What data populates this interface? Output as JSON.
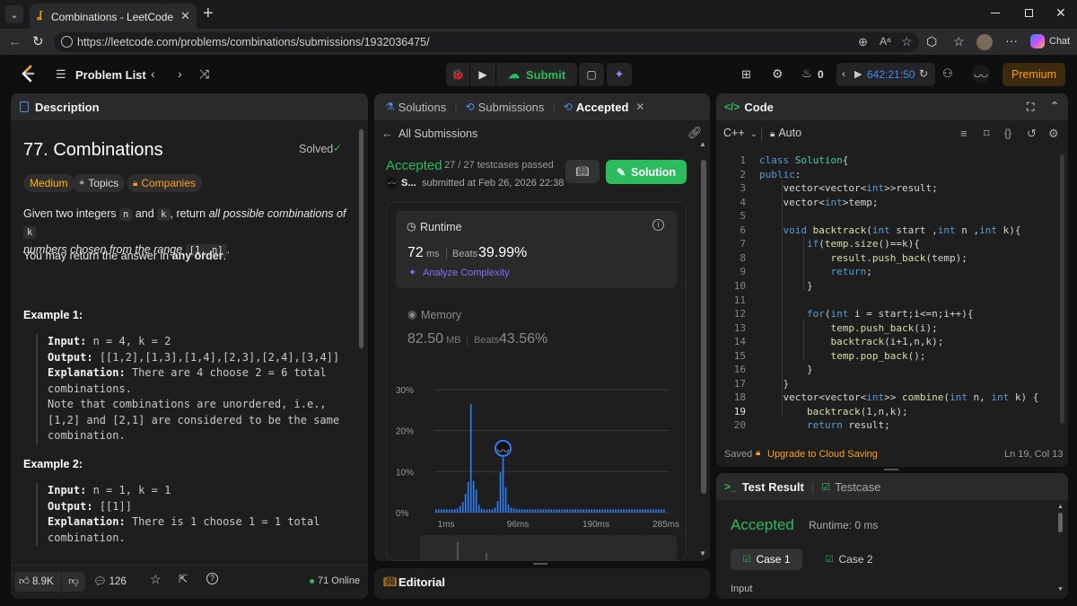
{
  "browser": {
    "tab_title": "Combinations - LeetCode",
    "url": "https://leetcode.com/problems/combinations/submissions/1932036475/",
    "chat_label": "Chat"
  },
  "nav": {
    "problem_list": "Problem List",
    "submit": "Submit",
    "streak": "0",
    "timer": "642:21:50",
    "premium": "Premium"
  },
  "description": {
    "tab": "Description",
    "title": "77. Combinations",
    "solved": "Solved",
    "difficulty": "Medium",
    "topics": "Topics",
    "companies": "Companies",
    "p1_a": "Given two integers",
    "p1_n": "n",
    "p1_and": "and",
    "p1_k": "k",
    "p1_return": ", return",
    "p1_em1": "all possible combinations of",
    "p1_k2": "k",
    "p1_em2": "numbers chosen from the range",
    "p1_range": "[1, n]",
    "p1_dot": ".",
    "p2_a": "You may return the answer in",
    "p2_b": "any order",
    "p2_c": ".",
    "ex1_title": "Example 1:",
    "ex1_input_label": "Input:",
    "ex1_input": "n = 4, k = 2",
    "ex1_output_label": "Output:",
    "ex1_output": "[[1,2],[1,3],[1,4],[2,3],[2,4],[3,4]]",
    "ex1_expl_label": "Explanation:",
    "ex1_expl_1": "There are 4 choose 2 = 6 total",
    "ex1_expl_2": "combinations.",
    "ex1_expl_3": "Note that combinations are unordered, i.e.,",
    "ex1_expl_4": "[1,2] and [2,1] are considered to be the same",
    "ex1_expl_5": "combination.",
    "ex2_title": "Example 2:",
    "ex2_input_label": "Input:",
    "ex2_input": "n = 1, k = 1",
    "ex2_output_label": "Output:",
    "ex2_output": "[[1]]",
    "ex2_expl_label": "Explanation:",
    "ex2_expl_1": "There is 1 choose 1 = 1 total",
    "ex2_expl_2": "combination.",
    "likes": "8.9K",
    "comments": "126",
    "online": "71 Online"
  },
  "submission": {
    "tabs": [
      "Solutions",
      "Submissions",
      "Accepted"
    ],
    "all_submissions": "All Submissions",
    "status": "Accepted",
    "testcases": "27 / 27 testcases passed",
    "user": "S...",
    "submitted": "submitted at Feb 26, 2026 22:38",
    "solution_btn": "Solution",
    "runtime_label": "Runtime",
    "runtime_value": "72",
    "runtime_unit": "ms",
    "beats_label": "Beats",
    "runtime_beats": "39.99%",
    "analyze": "Analyze Complexity",
    "memory_label": "Memory",
    "memory_value": "82.50",
    "memory_unit": "MB",
    "memory_beats": "43.56%",
    "editorial": "Editorial"
  },
  "chart_data": {
    "type": "bar",
    "title": "",
    "xlabel": "",
    "ylabel": "",
    "ylim": [
      0,
      30
    ],
    "yticks": [
      "30%",
      "20%",
      "10%",
      "0%"
    ],
    "xticks": [
      "1ms",
      "96ms",
      "190ms",
      "285ms"
    ],
    "series": [
      {
        "values": [
          0.8,
          0.8,
          0.8,
          0.8,
          0.8,
          0.8,
          0.8,
          0.8,
          1,
          1.6,
          2.6,
          4.6,
          7.5,
          26.5,
          7.7,
          5.6,
          1.9,
          1,
          0.8,
          0.8,
          0.8,
          0.8,
          1.2,
          2.8,
          9.8,
          13.5,
          6.2,
          2,
          1.2,
          1,
          0.9,
          0.8,
          0.8,
          0.8,
          0.8,
          0.8,
          0.8,
          0.8,
          0.8,
          0.8,
          0.8,
          0.8,
          0.8,
          0.8,
          0.8,
          0.8,
          0.8,
          0.8,
          0.8,
          0.8,
          0.8,
          0.8,
          0.8,
          0.8,
          0.8,
          0.8,
          0.8,
          0.8,
          0.8,
          0.8,
          0.8,
          0.8,
          0.8,
          0.8,
          0.8,
          0.8,
          0.8,
          0.8,
          0.8,
          0.8,
          0.8,
          0.8,
          0.8,
          0.8,
          0.8,
          0.8,
          0.8,
          0.8,
          0.8,
          0.8,
          0.8,
          0.8,
          0.8,
          0.8,
          0.8,
          0.8
        ]
      }
    ],
    "highlight_index": 25,
    "grid": true,
    "bar_color": "#2d7ff9"
  },
  "code": {
    "tab": "Code",
    "language": "C++",
    "auto": "Auto",
    "lines": [
      [
        [
          "kw",
          "class "
        ],
        [
          "ty",
          "Solution"
        ],
        [
          "",
          "{"
        ]
      ],
      [
        [
          "kw",
          "public"
        ],
        [
          "",
          ":"
        ]
      ],
      [
        [
          "",
          "    vector<vector<"
        ],
        [
          "kw",
          "int"
        ],
        [
          "",
          ">>result;"
        ]
      ],
      [
        [
          "",
          "    vector<"
        ],
        [
          "kw",
          "int"
        ],
        [
          "",
          ">temp;"
        ]
      ],
      [
        [
          "",
          ""
        ]
      ],
      [
        [
          "",
          "    "
        ],
        [
          "kw",
          "void "
        ],
        [
          "fn",
          "backtrack"
        ],
        [
          "",
          "("
        ],
        [
          "kw",
          "int "
        ],
        [
          "",
          "start ,"
        ],
        [
          "kw",
          "int "
        ],
        [
          "",
          "n ,"
        ],
        [
          "kw",
          "int "
        ],
        [
          "",
          "k){"
        ]
      ],
      [
        [
          "",
          "        "
        ],
        [
          "kw",
          "if"
        ],
        [
          "",
          "("
        ],
        [
          "fn",
          "temp.size"
        ],
        [
          "",
          "()==k){"
        ]
      ],
      [
        [
          "",
          "            "
        ],
        [
          "fn",
          "result.push_back"
        ],
        [
          "",
          "(temp);"
        ]
      ],
      [
        [
          "",
          "            "
        ],
        [
          "kw",
          "return"
        ],
        [
          "",
          ";"
        ]
      ],
      [
        [
          "",
          "        }"
        ]
      ],
      [
        [
          "",
          ""
        ]
      ],
      [
        [
          "",
          "        "
        ],
        [
          "kw",
          "for"
        ],
        [
          "",
          "("
        ],
        [
          "kw",
          "int "
        ],
        [
          "",
          "i = start;i<=n;i++){"
        ]
      ],
      [
        [
          "",
          "            "
        ],
        [
          "fn",
          "temp.push_back"
        ],
        [
          "",
          "(i);"
        ]
      ],
      [
        [
          "",
          "            "
        ],
        [
          "fn",
          "backtrack"
        ],
        [
          "",
          "(i+1,n,k);"
        ]
      ],
      [
        [
          "",
          "            "
        ],
        [
          "fn",
          "temp.pop_back"
        ],
        [
          "",
          "();"
        ]
      ],
      [
        [
          "",
          "        }"
        ]
      ],
      [
        [
          "",
          "    }"
        ]
      ],
      [
        [
          "",
          "    vector<vector<"
        ],
        [
          "kw",
          "int"
        ],
        [
          "",
          ">> "
        ],
        [
          "fn",
          "combine"
        ],
        [
          "",
          "("
        ],
        [
          "kw",
          "int "
        ],
        [
          "",
          "n, "
        ],
        [
          "kw",
          "int "
        ],
        [
          "",
          "k) {"
        ]
      ],
      [
        [
          "",
          "        "
        ],
        [
          "fn",
          "backtrack"
        ],
        [
          "",
          "(1,n,k);"
        ]
      ],
      [
        [
          "",
          "        "
        ],
        [
          "kw",
          "return "
        ],
        [
          "",
          "result;"
        ]
      ]
    ],
    "current_line": 19,
    "saved": "Saved",
    "upgrade": "Upgrade to Cloud Saving",
    "position": "Ln 19, Col 13"
  },
  "test": {
    "tab_result": "Test Result",
    "tab_testcase": "Testcase",
    "status": "Accepted",
    "runtime": "Runtime: 0 ms",
    "case1": "Case 1",
    "case2": "Case 2",
    "input_label": "Input"
  },
  "colors": {
    "accent_green": "#2cbb5d",
    "medium": "#ffb800",
    "orange": "#ffa116"
  }
}
